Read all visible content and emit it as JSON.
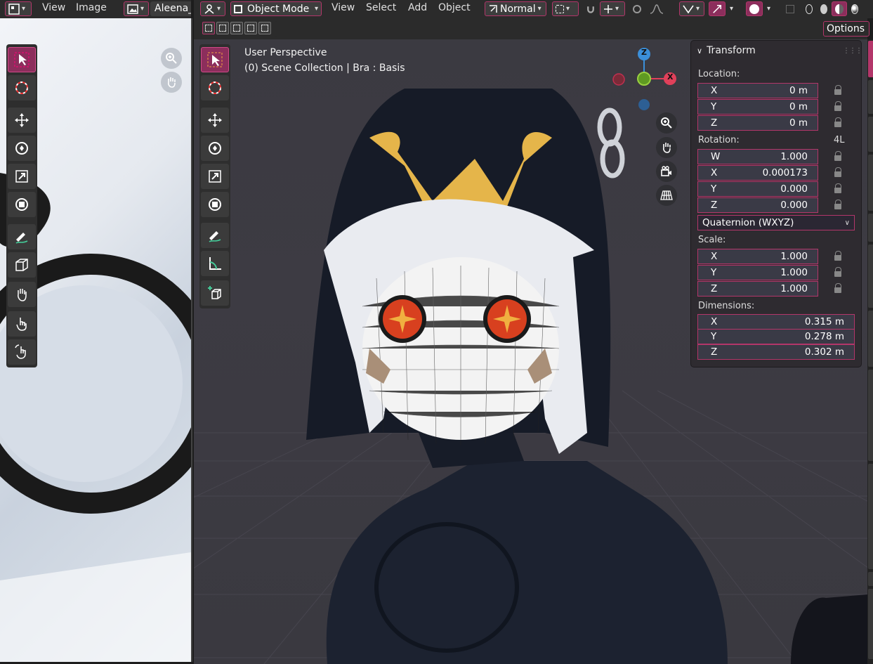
{
  "image_editor": {
    "menu": [
      "View",
      "Image"
    ],
    "image_name": "Aleena_"
  },
  "viewport_header": {
    "mode": "Object Mode",
    "menu": [
      "View",
      "Select",
      "Add",
      "Object"
    ],
    "orientation": "Normal",
    "options_label": "Options"
  },
  "viewport": {
    "perspective": "User Perspective",
    "collection": "(0) Scene Collection | Bra : Basis",
    "gizmo": {
      "z": "Z",
      "x": "X"
    }
  },
  "transform": {
    "title": "Transform",
    "location_label": "Location:",
    "location": [
      {
        "axis": "X",
        "value": "0 m"
      },
      {
        "axis": "Y",
        "value": "0 m"
      },
      {
        "axis": "Z",
        "value": "0 m"
      }
    ],
    "rotation_label": "Rotation:",
    "rotation_mode_tag": "4L",
    "rotation": [
      {
        "axis": "W",
        "value": "1.000"
      },
      {
        "axis": "X",
        "value": "0.000173"
      },
      {
        "axis": "Y",
        "value": "0.000"
      },
      {
        "axis": "Z",
        "value": "0.000"
      }
    ],
    "rotation_mode": "Quaternion (WXYZ)",
    "scale_label": "Scale:",
    "scale": [
      {
        "axis": "X",
        "value": "1.000"
      },
      {
        "axis": "Y",
        "value": "1.000"
      },
      {
        "axis": "Z",
        "value": "1.000"
      }
    ],
    "dimensions_label": "Dimensions:",
    "dimensions": [
      {
        "axis": "X",
        "value": "0.315 m"
      },
      {
        "axis": "Y",
        "value": "0.278 m"
      },
      {
        "axis": "Z",
        "value": "0.302 m"
      }
    ]
  },
  "colors": {
    "accent": "#b3366a",
    "panel": "#2e2b30",
    "field": "#3a3a46",
    "gizmo_x": "#e0405a",
    "gizmo_y": "#7fbf2a",
    "gizmo_z": "#3b8fd9"
  }
}
